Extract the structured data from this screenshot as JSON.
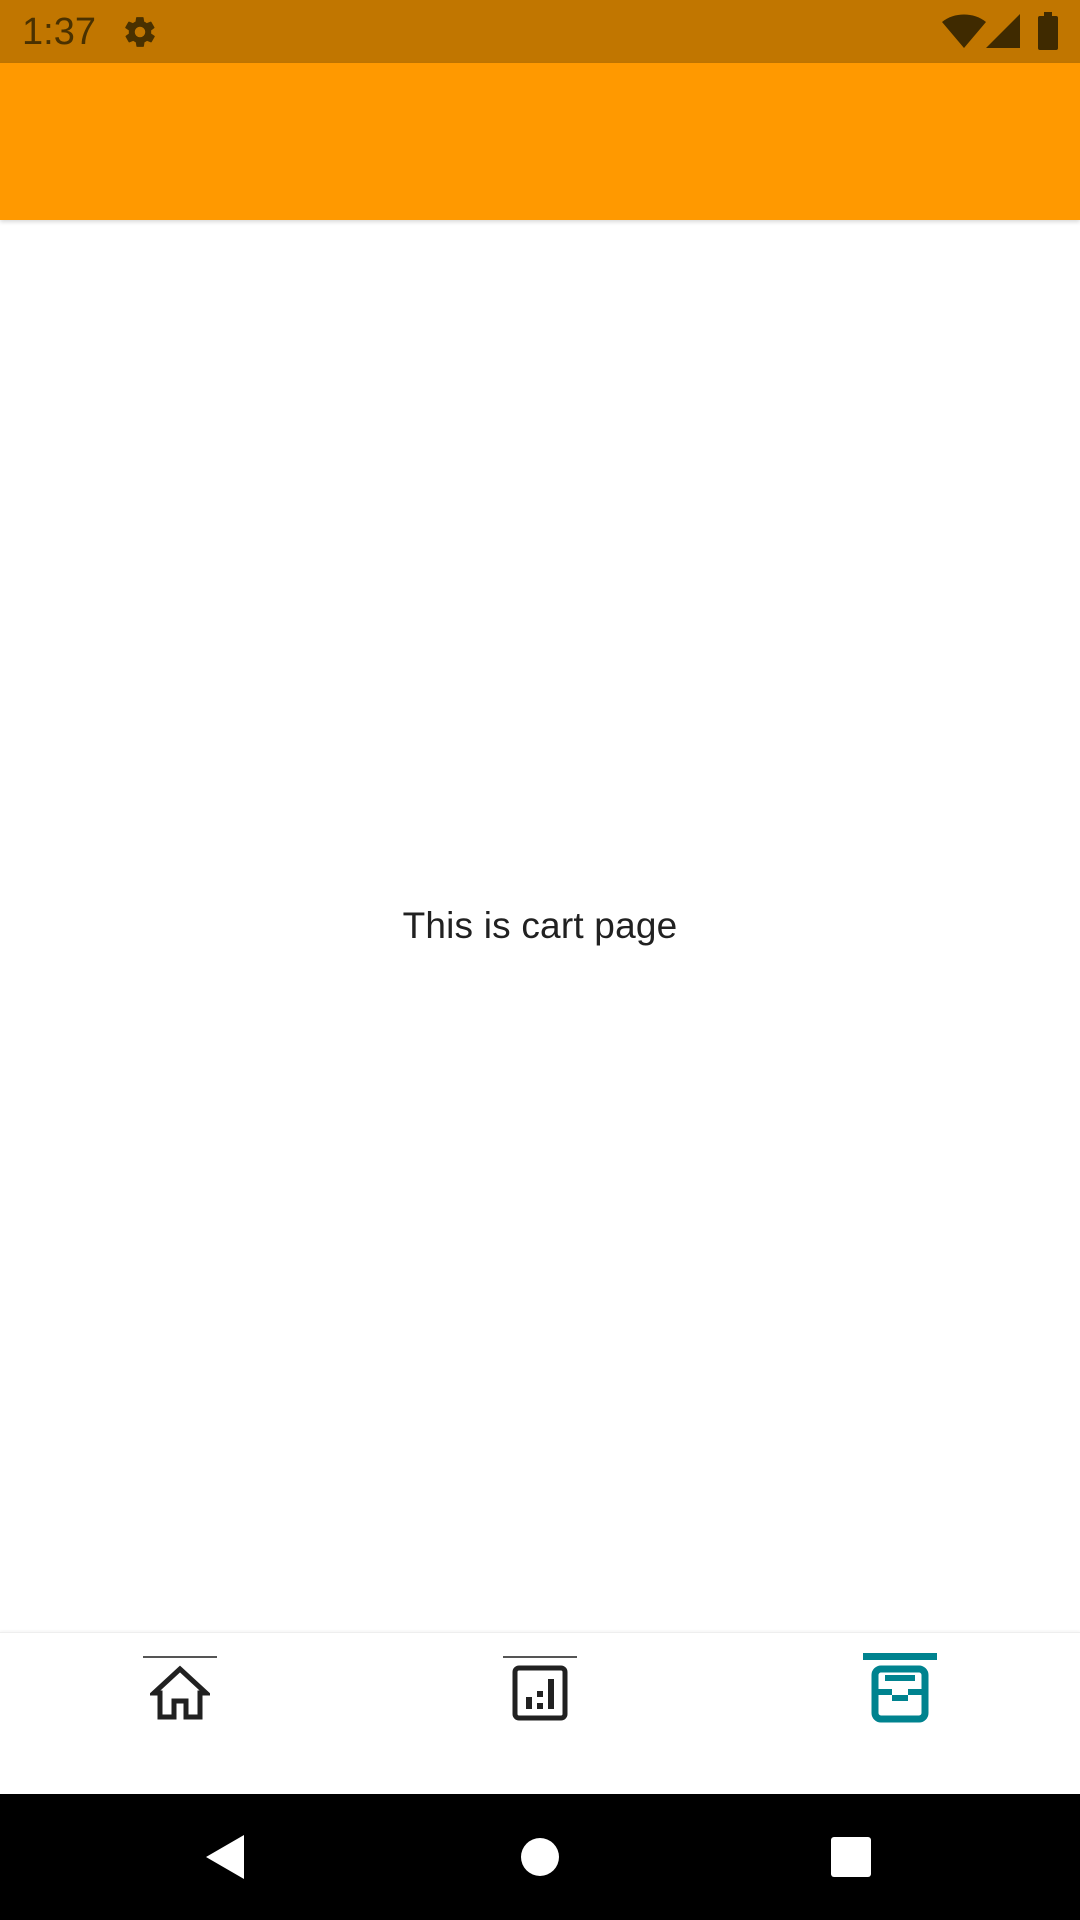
{
  "status_bar": {
    "time": "1:37",
    "icons": [
      "gear-icon",
      "wifi-icon",
      "signal-icon",
      "battery-icon"
    ]
  },
  "app_bar": {
    "color": "#FF9900"
  },
  "page": {
    "message": "This is cart page"
  },
  "bottom_nav": {
    "items": [
      {
        "icon": "home-icon",
        "active": false
      },
      {
        "icon": "chart-icon",
        "active": false
      },
      {
        "icon": "cart-icon",
        "active": true
      }
    ],
    "active_color": "#00838F",
    "inactive_color": "#212121"
  },
  "system_nav": {
    "buttons": [
      "back-icon",
      "home-circle-icon",
      "recents-icon"
    ]
  },
  "colors": {
    "status_bar": "#C17600",
    "app_bar": "#FF9900",
    "accent": "#00838F"
  }
}
